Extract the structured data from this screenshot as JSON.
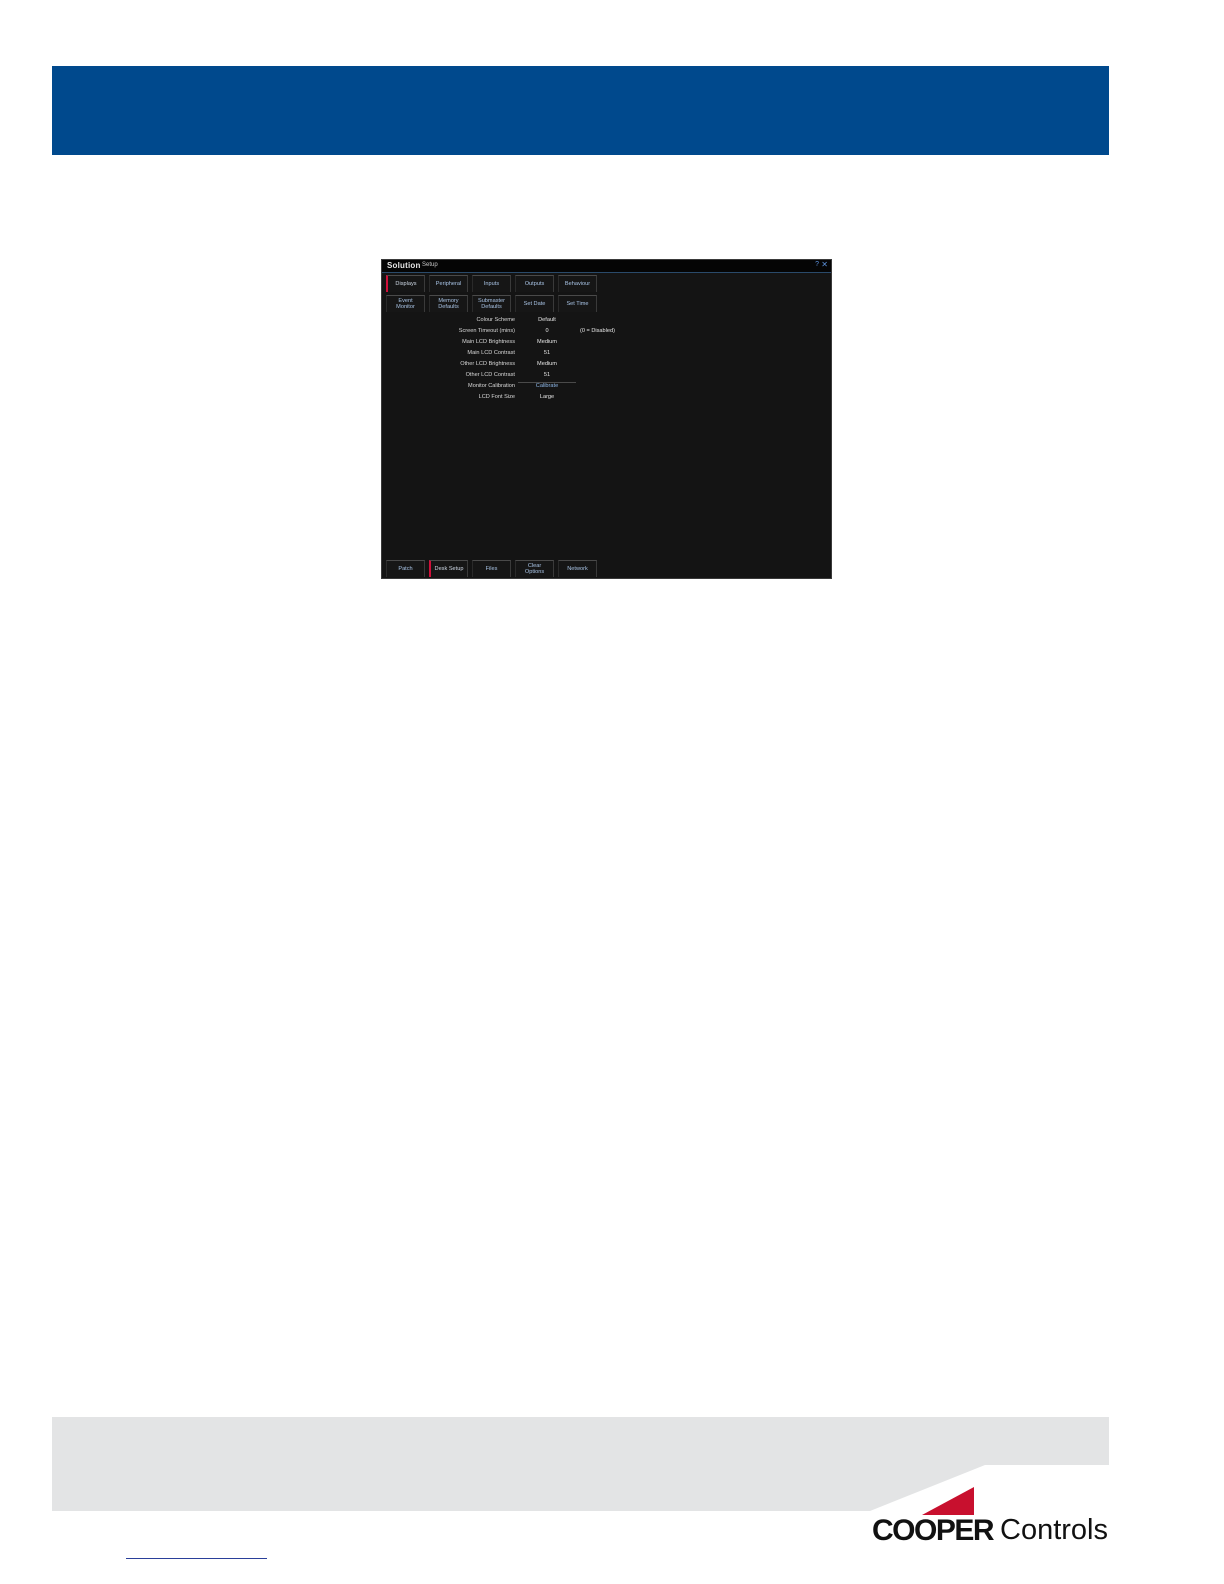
{
  "screen": {
    "logo": "Solution",
    "title": "Setup",
    "help_glyph": "?",
    "close_glyph": "✕",
    "top_tabs": [
      {
        "label": "Displays"
      },
      {
        "label": "Peripheral"
      },
      {
        "label": "Inputs"
      },
      {
        "label": "Outputs"
      },
      {
        "label": "Behaviour"
      }
    ],
    "sub_tabs": [
      {
        "label": "Event\nMonitor"
      },
      {
        "label": "Memory\nDefaults"
      },
      {
        "label": "Submaster\nDefaults"
      },
      {
        "label": "Set Date"
      },
      {
        "label": "Set Time"
      }
    ],
    "settings": [
      {
        "label": "Colour Scheme",
        "value": "Default"
      },
      {
        "label": "Screen Timeout (mins)",
        "value": "0",
        "note": "(0 = Disabled)"
      },
      {
        "label": "Main LCD Brightness",
        "value": "Medium"
      },
      {
        "label": "Main LCD Contrast",
        "value": "51"
      },
      {
        "label": "Other LCD Brightness",
        "value": "Medium"
      },
      {
        "label": "Other LCD Contrast",
        "value": "51"
      },
      {
        "label": "Monitor Calibration",
        "value": "Calibrate"
      },
      {
        "label": "LCD Font Size",
        "value": "Large"
      }
    ],
    "bottom_tabs": [
      {
        "label": "Patch"
      },
      {
        "label": "Desk Setup"
      },
      {
        "label": "Files"
      },
      {
        "label": "Clear\nOptions"
      },
      {
        "label": "Network"
      }
    ]
  },
  "footer": {
    "brand_bold": "COOPER",
    "brand_regular": "Controls"
  },
  "colors": {
    "banner": "#00498d",
    "accent_red": "#c8102e"
  }
}
